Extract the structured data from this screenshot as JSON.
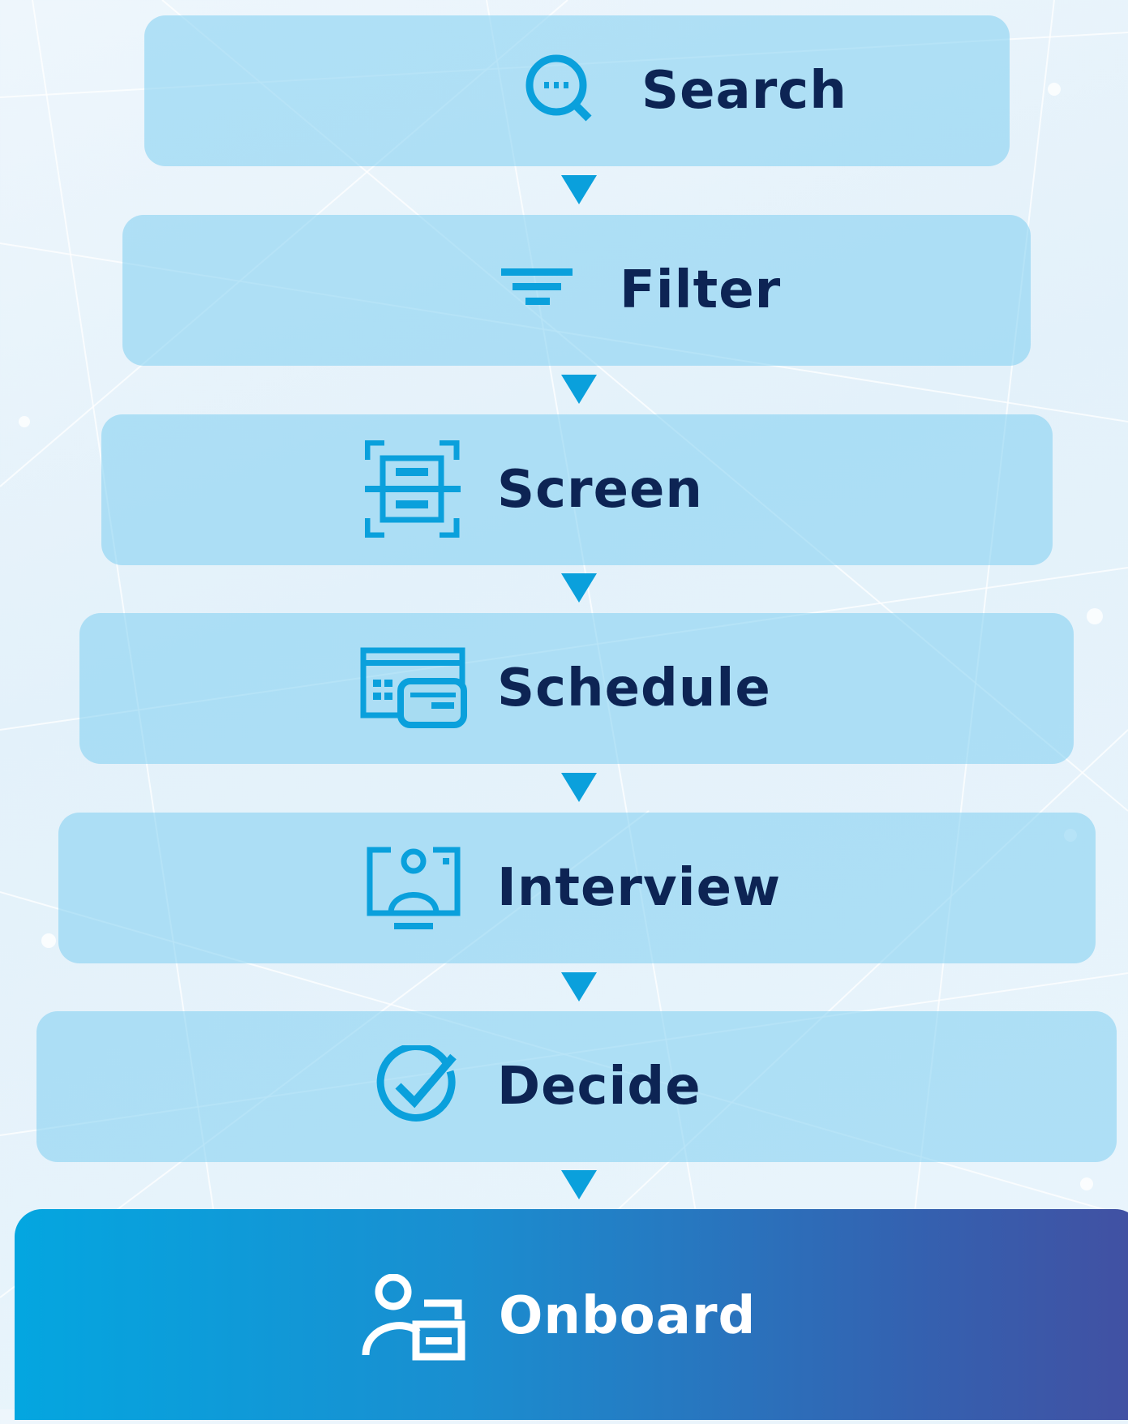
{
  "steps": [
    {
      "label": "Search",
      "icon": "search-icon"
    },
    {
      "label": "Filter",
      "icon": "filter-icon"
    },
    {
      "label": "Screen",
      "icon": "screen-scan-icon"
    },
    {
      "label": "Schedule",
      "icon": "schedule-icon"
    },
    {
      "label": "Interview",
      "icon": "interview-icon"
    },
    {
      "label": "Decide",
      "icon": "check-circle-icon"
    }
  ],
  "final_step": {
    "label": "Onboard",
    "icon": "onboard-icon"
  },
  "colors": {
    "step_fill": "#7dcdf0",
    "label_text": "#0d2454",
    "icon": "#0aa0dc",
    "arrow": "#0aa0dc",
    "final_gradient_start": "#04a6e0",
    "final_gradient_end": "#4250a2",
    "final_text": "#ffffff"
  }
}
